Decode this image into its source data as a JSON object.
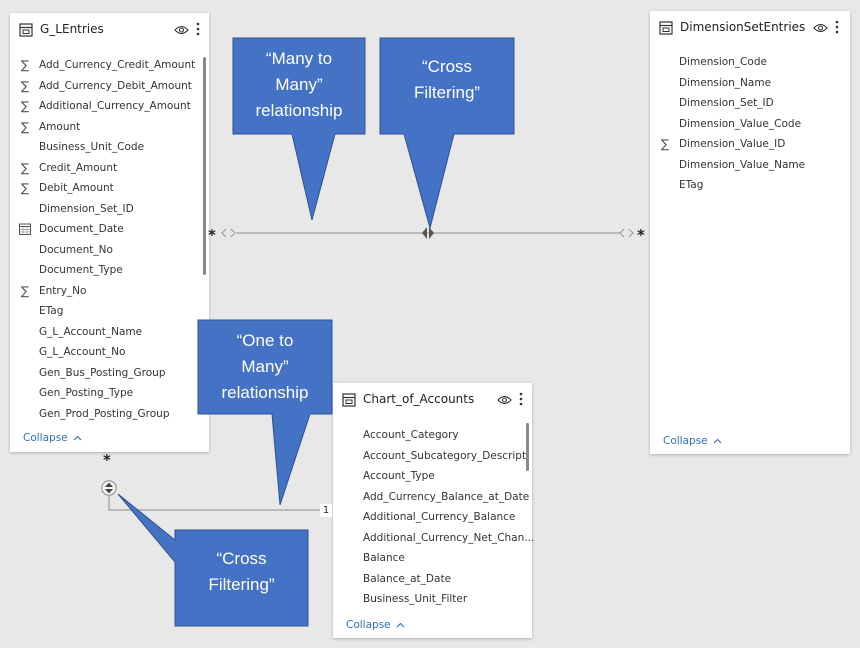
{
  "tables": {
    "gl_entries": {
      "title": "G_LEntries",
      "fields": [
        {
          "name": "Add_Currency_Credit_Amount",
          "icon": "sigma-icon"
        },
        {
          "name": "Add_Currency_Debit_Amount",
          "icon": "sigma-icon"
        },
        {
          "name": "Additional_Currency_Amount",
          "icon": "sigma-icon"
        },
        {
          "name": "Amount",
          "icon": "sigma-icon"
        },
        {
          "name": "Business_Unit_Code",
          "icon": ""
        },
        {
          "name": "Credit_Amount",
          "icon": "sigma-icon"
        },
        {
          "name": "Debit_Amount",
          "icon": "sigma-icon"
        },
        {
          "name": "Dimension_Set_ID",
          "icon": ""
        },
        {
          "name": "Document_Date",
          "icon": "calendar-icon"
        },
        {
          "name": "Document_No",
          "icon": ""
        },
        {
          "name": "Document_Type",
          "icon": ""
        },
        {
          "name": "Entry_No",
          "icon": "sigma-icon"
        },
        {
          "name": "ETag",
          "icon": ""
        },
        {
          "name": "G_L_Account_Name",
          "icon": ""
        },
        {
          "name": "G_L_Account_No",
          "icon": ""
        },
        {
          "name": "Gen_Bus_Posting_Group",
          "icon": ""
        },
        {
          "name": "Gen_Posting_Type",
          "icon": ""
        },
        {
          "name": "Gen_Prod_Posting_Group",
          "icon": ""
        }
      ],
      "collapse_label": "Collapse"
    },
    "dimension_set_entries": {
      "title": "DimensionSetEntries",
      "fields": [
        {
          "name": "Dimension_Code",
          "icon": ""
        },
        {
          "name": "Dimension_Name",
          "icon": ""
        },
        {
          "name": "Dimension_Set_ID",
          "icon": ""
        },
        {
          "name": "Dimension_Value_Code",
          "icon": ""
        },
        {
          "name": "Dimension_Value_ID",
          "icon": "sigma-icon"
        },
        {
          "name": "Dimension_Value_Name",
          "icon": ""
        },
        {
          "name": "ETag",
          "icon": ""
        }
      ],
      "collapse_label": "Collapse"
    },
    "chart_of_accounts": {
      "title": "Chart_of_Accounts",
      "fields": [
        {
          "name": "Account_Category",
          "icon": ""
        },
        {
          "name": "Account_Subcategory_Descript",
          "icon": ""
        },
        {
          "name": "Account_Type",
          "icon": ""
        },
        {
          "name": "Add_Currency_Balance_at_Date",
          "icon": ""
        },
        {
          "name": "Additional_Currency_Balance",
          "icon": ""
        },
        {
          "name": "Additional_Currency_Net_Chan...",
          "icon": ""
        },
        {
          "name": "Balance",
          "icon": ""
        },
        {
          "name": "Balance_at_Date",
          "icon": ""
        },
        {
          "name": "Business_Unit_Filter",
          "icon": ""
        }
      ],
      "collapse_label": "Collapse"
    }
  },
  "relationships": {
    "many_symbol": "*",
    "one_symbol": "1"
  },
  "callouts": {
    "many_to_many": [
      "“Many to",
      "Many”",
      "relationship"
    ],
    "cross_filtering_top": [
      "“Cross",
      "Filtering”"
    ],
    "one_to_many": [
      "“One to",
      "Many”",
      "relationship"
    ],
    "cross_filtering_bottom": [
      "“Cross",
      "Filtering”"
    ]
  },
  "colors": {
    "callout_fill": "#4472C4",
    "callout_border": "#2F528F",
    "link_text": "#2f6fb8",
    "connector": "#a0a0a0"
  }
}
